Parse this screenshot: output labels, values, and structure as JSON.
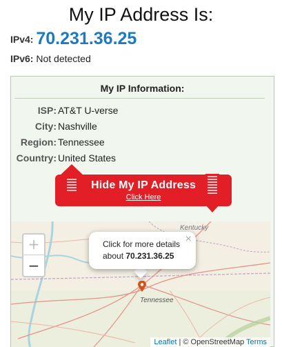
{
  "header": {
    "title": "My IP Address Is:"
  },
  "ip": {
    "ipv4_label": "IPv4:",
    "ipv4_value": "70.231.36.25",
    "ipv6_label": "IPv6:",
    "ipv6_value": "Not detected"
  },
  "info": {
    "heading": "My IP Information:",
    "rows": [
      {
        "key": "ISP:",
        "value": "AT&T U-verse"
      },
      {
        "key": "City:",
        "value": "Nashville"
      },
      {
        "key": "Region:",
        "value": "Tennessee"
      },
      {
        "key": "Country:",
        "value": "United States"
      }
    ]
  },
  "hide_button": {
    "label": "Hide My IP Address",
    "sublabel": "Click Here"
  },
  "map": {
    "zoom_in": "+",
    "zoom_out": "−",
    "popup_text": "Click for more details",
    "popup_about": "about",
    "popup_ip": "70.231.36.25",
    "popup_close": "×",
    "state_label": "Tennessee",
    "kentucky_label": "Kentucky",
    "attribution_leaflet": "Leaflet",
    "attribution_osm": " | © OpenStreetMap ",
    "attribution_terms": "Terms"
  },
  "colors": {
    "ip_blue": "#1b7ac2",
    "button_red": "#e21f26",
    "panel_bg": "#f1f6ee",
    "marker": "#d4541c"
  }
}
